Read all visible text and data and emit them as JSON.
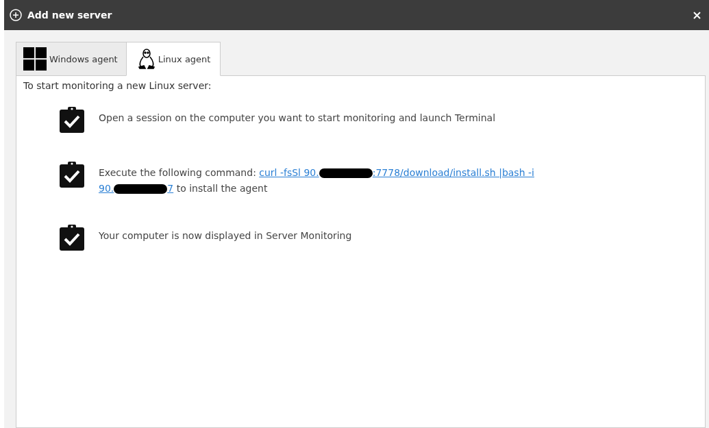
{
  "window": {
    "title": "Add new server"
  },
  "tabs": [
    {
      "label": "Windows agent",
      "kind": "windows",
      "selected": false
    },
    {
      "label": "Linux agent",
      "kind": "penguin",
      "selected": true
    }
  ],
  "intro": "To start monitoring a new Linux server:",
  "steps": [
    {
      "checked": true,
      "lines": [
        [
          {
            "kind": "text",
            "text": "Open a session on the computer you want to start monitoring and launch Terminal"
          }
        ]
      ]
    },
    {
      "checked": true,
      "lines": [
        [
          {
            "kind": "text",
            "text": "Execute the following command: "
          },
          {
            "kind": "link",
            "text": "curl -fsSl 90."
          },
          {
            "kind": "redaction"
          },
          {
            "kind": "link",
            "text": ":7778/download/install.sh |bash -i"
          }
        ],
        [
          {
            "kind": "link",
            "text": "90."
          },
          {
            "kind": "redaction"
          },
          {
            "kind": "link",
            "text": "7"
          },
          {
            "kind": "text",
            "text": " to install the agent"
          }
        ]
      ]
    },
    {
      "checked": true,
      "lines": [
        [
          {
            "kind": "text",
            "text": "Your computer is now displayed in Server Monitoring"
          }
        ]
      ]
    }
  ]
}
